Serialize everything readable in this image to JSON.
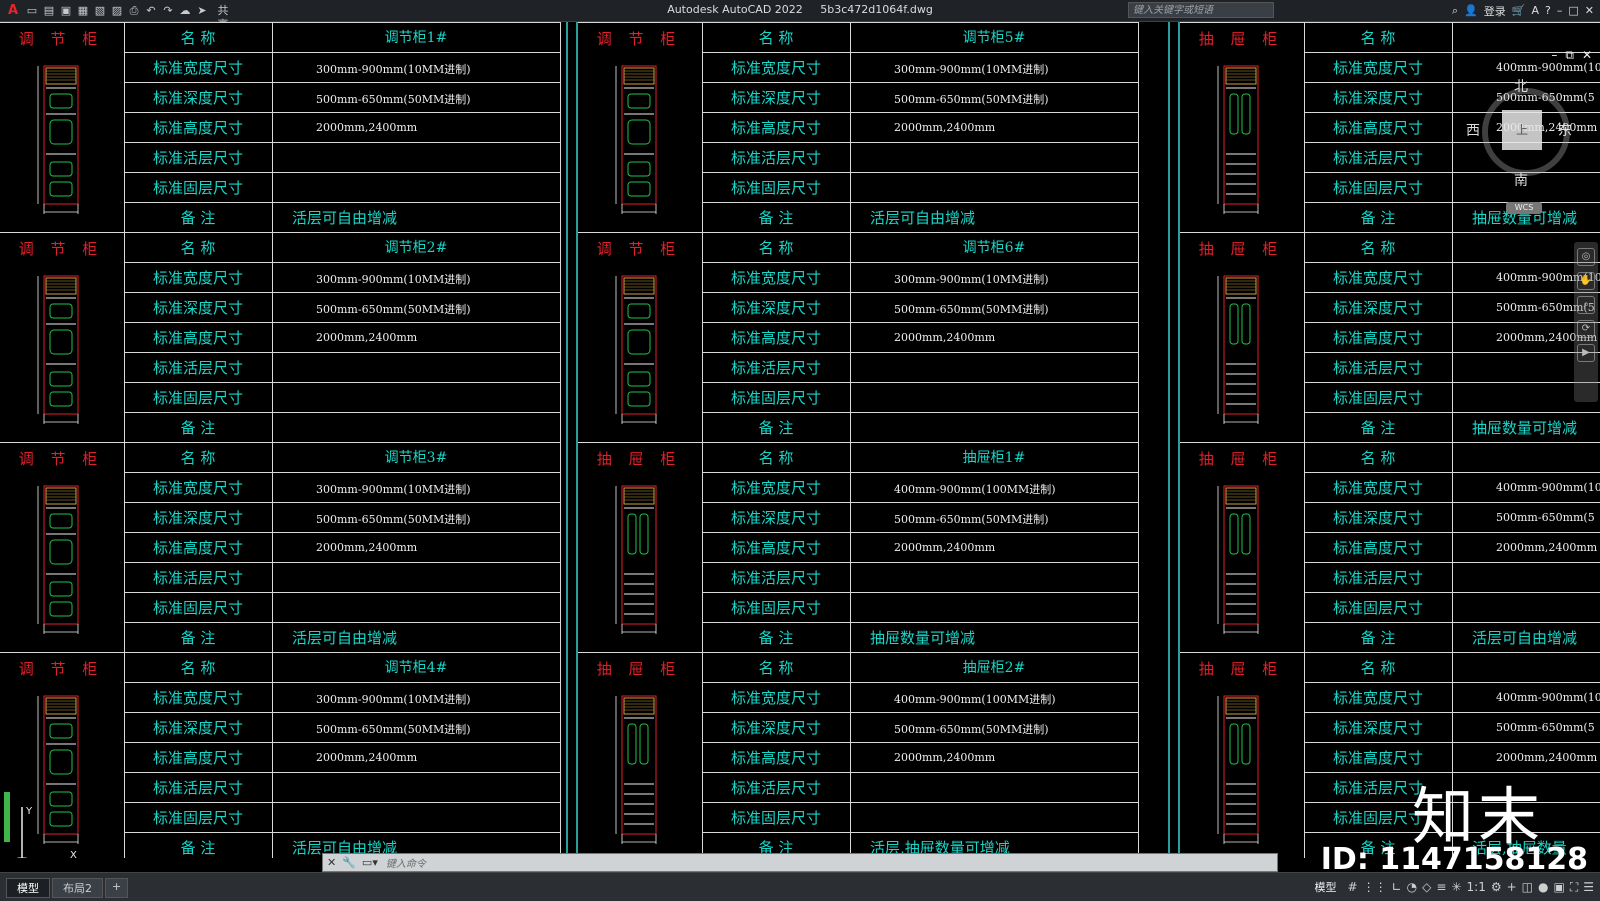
{
  "app": {
    "title": "Autodesk AutoCAD 2022",
    "filename": "5b3c472d1064f.dwg",
    "share_label": "共享",
    "search_placeholder": "键入关键字或短语",
    "login_label": "登录"
  },
  "labels": {
    "name": "名 称",
    "width": "标准宽度尺寸",
    "depth": "标准深度尺寸",
    "height": "标准高度尺寸",
    "movable_shelf": "标准活层尺寸",
    "fixed_shelf": "标准固层尺寸",
    "remark": "备 注"
  },
  "types": {
    "adjust": "调 节 柜",
    "drawer": "抽 屉 柜"
  },
  "columns": [
    {
      "blocks": [
        {
          "type": "调 节 柜",
          "name": "调节柜1#",
          "width": "300mm-900mm(10MM进制)",
          "depth": "500mm-650mm(50MM进制)",
          "height": "2000mm,2400mm",
          "remark": "活层可自由增减"
        },
        {
          "type": "调 节 柜",
          "name": "调节柜2#",
          "width": "300mm-900mm(10MM进制)",
          "depth": "500mm-650mm(50MM进制)",
          "height": "2000mm,2400mm",
          "remark": ""
        },
        {
          "type": "调 节 柜",
          "name": "调节柜3#",
          "width": "300mm-900mm(10MM进制)",
          "depth": "500mm-650mm(50MM进制)",
          "height": "2000mm,2400mm",
          "remark": "活层可自由增减"
        },
        {
          "type": "调 节 柜",
          "name": "调节柜4#",
          "width": "300mm-900mm(10MM进制)",
          "depth": "500mm-650mm(50MM进制)",
          "height": "2000mm,2400mm",
          "remark": "活层可自由增减"
        }
      ]
    },
    {
      "blocks": [
        {
          "type": "调 节 柜",
          "name": "调节柜5#",
          "width": "300mm-900mm(10MM进制)",
          "depth": "500mm-650mm(50MM进制)",
          "height": "2000mm,2400mm",
          "remark": "活层可自由增减"
        },
        {
          "type": "调 节 柜",
          "name": "调节柜6#",
          "width": "300mm-900mm(10MM进制)",
          "depth": "500mm-650mm(50MM进制)",
          "height": "2000mm,2400mm",
          "remark": ""
        },
        {
          "type": "抽 屉 柜",
          "name": "抽屉柜1#",
          "width": "400mm-900mm(100MM进制)",
          "depth": "500mm-650mm(50MM进制)",
          "height": "2000mm,2400mm",
          "remark": "抽屉数量可增减"
        },
        {
          "type": "抽 屉 柜",
          "name": "抽屉柜2#",
          "width": "400mm-900mm(100MM进制)",
          "depth": "500mm-650mm(50MM进制)",
          "height": "2000mm,2400mm",
          "remark": "活层,抽屉数量可增减"
        }
      ]
    },
    {
      "blocks": [
        {
          "type": "抽 屉 柜",
          "name": "",
          "width": "400mm-900mm(10",
          "depth": "500mm-650mm(5",
          "height": "2000mm,2400mm",
          "remark": "抽屉数量可增减"
        },
        {
          "type": "抽 屉 柜",
          "name": "",
          "width": "400mm-900mm(10",
          "depth": "500mm-650mm(5",
          "height": "2000mm,2400mm",
          "remark": "抽屉数量可增减"
        },
        {
          "type": "抽 屉 柜",
          "name": "",
          "width": "400mm-900mm(10",
          "depth": "500mm-650mm(5",
          "height": "2000mm,2400mm",
          "remark": "活层可自由增减"
        },
        {
          "type": "抽 屉 柜",
          "name": "",
          "width": "400mm-900mm(10",
          "depth": "500mm-650mm(5",
          "height": "2000mm,2400mm",
          "remark": "活层,抽屉数量"
        }
      ]
    }
  ],
  "viewcube": {
    "north": "北",
    "south": "南",
    "east": "东",
    "west": "西",
    "top": "上",
    "wcs": "WCS"
  },
  "command": {
    "placeholder": "键入命令"
  },
  "layout_tabs": [
    "模型",
    "布局2"
  ],
  "status": {
    "model_label": "模型",
    "scale": "1:1"
  },
  "watermark": {
    "brand": "知末",
    "id": "ID: 1147158128"
  }
}
